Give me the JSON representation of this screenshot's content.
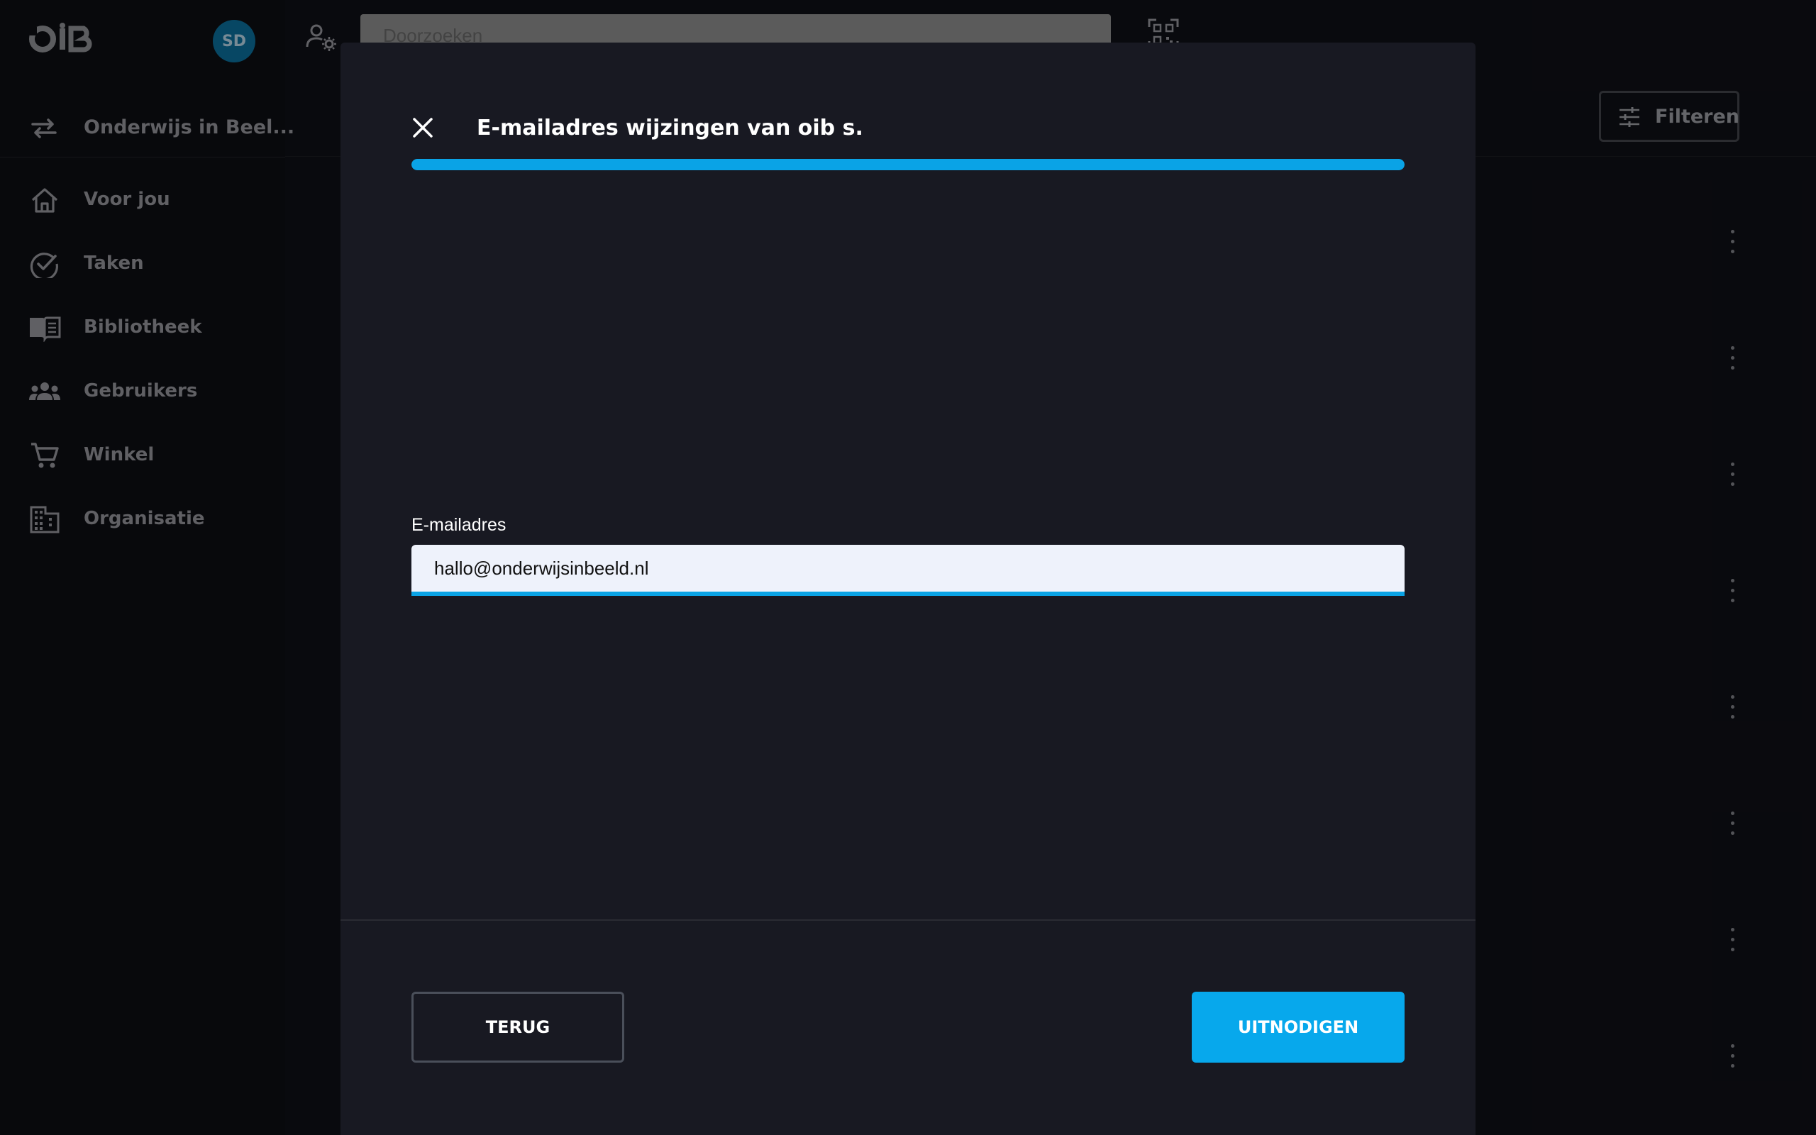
{
  "app": {
    "logo_text": "OiB",
    "avatar_initials": "SD"
  },
  "sidebar": {
    "org_name": "Onderwijs in Beel...",
    "items": [
      {
        "label": "Voor jou",
        "icon": "home-icon"
      },
      {
        "label": "Taken",
        "icon": "check-circle-icon"
      },
      {
        "label": "Bibliotheek",
        "icon": "book-icon"
      },
      {
        "label": "Gebruikers",
        "icon": "users-icon"
      },
      {
        "label": "Winkel",
        "icon": "cart-icon"
      },
      {
        "label": "Organisatie",
        "icon": "building-icon"
      }
    ]
  },
  "topbar": {
    "search_placeholder": "Doorzoeken",
    "filter_label": "Filteren"
  },
  "modal": {
    "title": "E-mailadres wijzingen van oib s.",
    "progress": 1.0,
    "field_label": "E-mailadres",
    "email_value": "hallo@onderwijsinbeeld.nl",
    "back_label": "TERUG",
    "invite_label": "UITNODIGEN"
  },
  "colors": {
    "accent": "#07a8ec",
    "modal_bg": "#181922",
    "page_bg": "#0d0e13"
  }
}
